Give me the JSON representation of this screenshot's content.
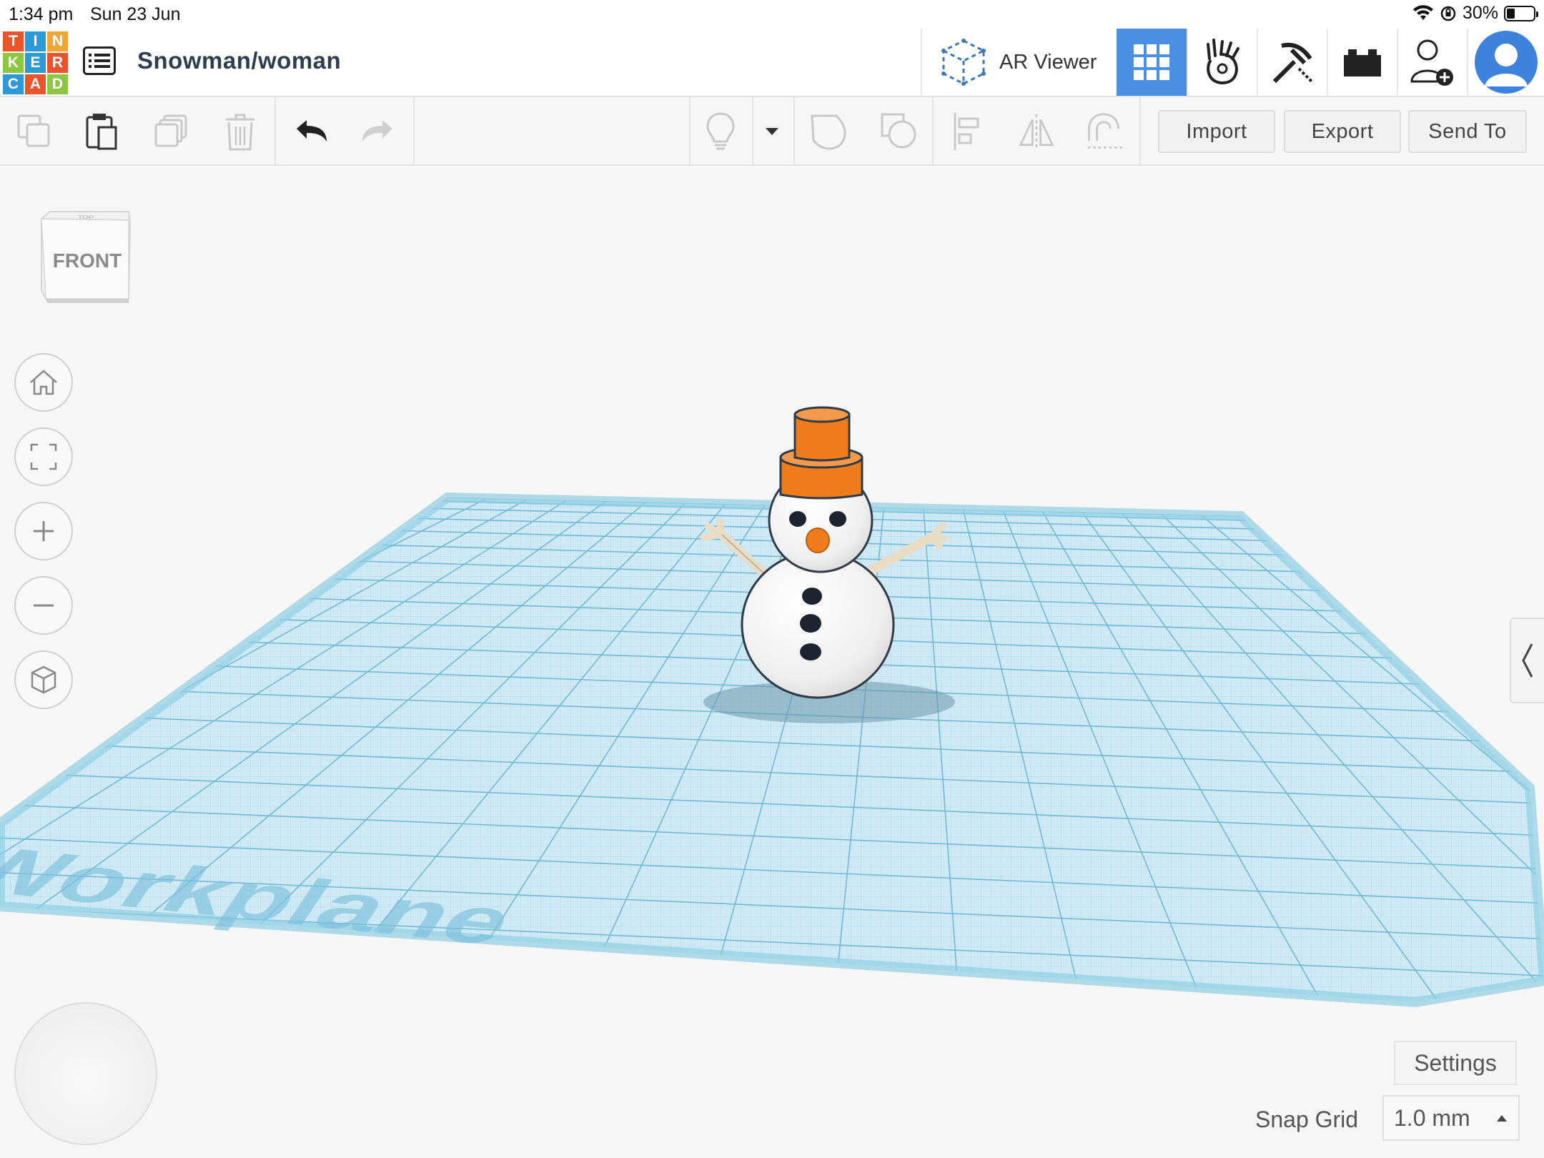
{
  "status_bar": {
    "time": "1:34 pm",
    "date": "Sun 23 Jun",
    "battery": "30%",
    "battery_level": 0.3
  },
  "header": {
    "logo_letters": [
      "T",
      "I",
      "N",
      "K",
      "E",
      "R",
      "C",
      "A",
      "D"
    ],
    "logo_colors": [
      "#e8542c",
      "#2b9ad6",
      "#f0a632",
      "#8dc63f",
      "#2b9ad6",
      "#e8542c",
      "#2b9ad6",
      "#e8542c",
      "#8dc63f"
    ],
    "design_title": "Snowman/woman",
    "ar_viewer_label": "AR Viewer",
    "active_view": "3d-design",
    "icons": [
      "design-list-icon",
      "ar-viewer-icon",
      "grid-view-icon",
      "codeblocks-icon",
      "minecraft-pickaxe-icon",
      "lego-brick-icon",
      "invite-user-icon",
      "avatar-icon"
    ],
    "accent_color": "#4a90e2"
  },
  "toolbar": {
    "import_label": "Import",
    "export_label": "Export",
    "send_to_label": "Send To",
    "icons": [
      "copy-icon",
      "paste-icon",
      "duplicate-icon",
      "delete-icon",
      "undo-icon",
      "redo-icon",
      "lightbulb-icon",
      "chevron-down-icon",
      "group-icon",
      "ungroup-icon",
      "align-icon",
      "mirror-icon",
      "magnet-icon"
    ]
  },
  "workspace": {
    "view_cube_front": "FRONT",
    "view_cube_top": "TOP",
    "workplane_label": "Workplane",
    "settings_label": "Settings",
    "snap_grid_label": "Snap Grid",
    "snap_grid_value": "1.0 mm",
    "nav_icons": [
      "home-icon",
      "fit-view-icon",
      "zoom-in-icon",
      "zoom-out-icon",
      "perspective-icon"
    ],
    "workplane_color": "#a8d8ec",
    "hat_color": "#f07d1c",
    "snow_color": "#f4f4f4"
  }
}
